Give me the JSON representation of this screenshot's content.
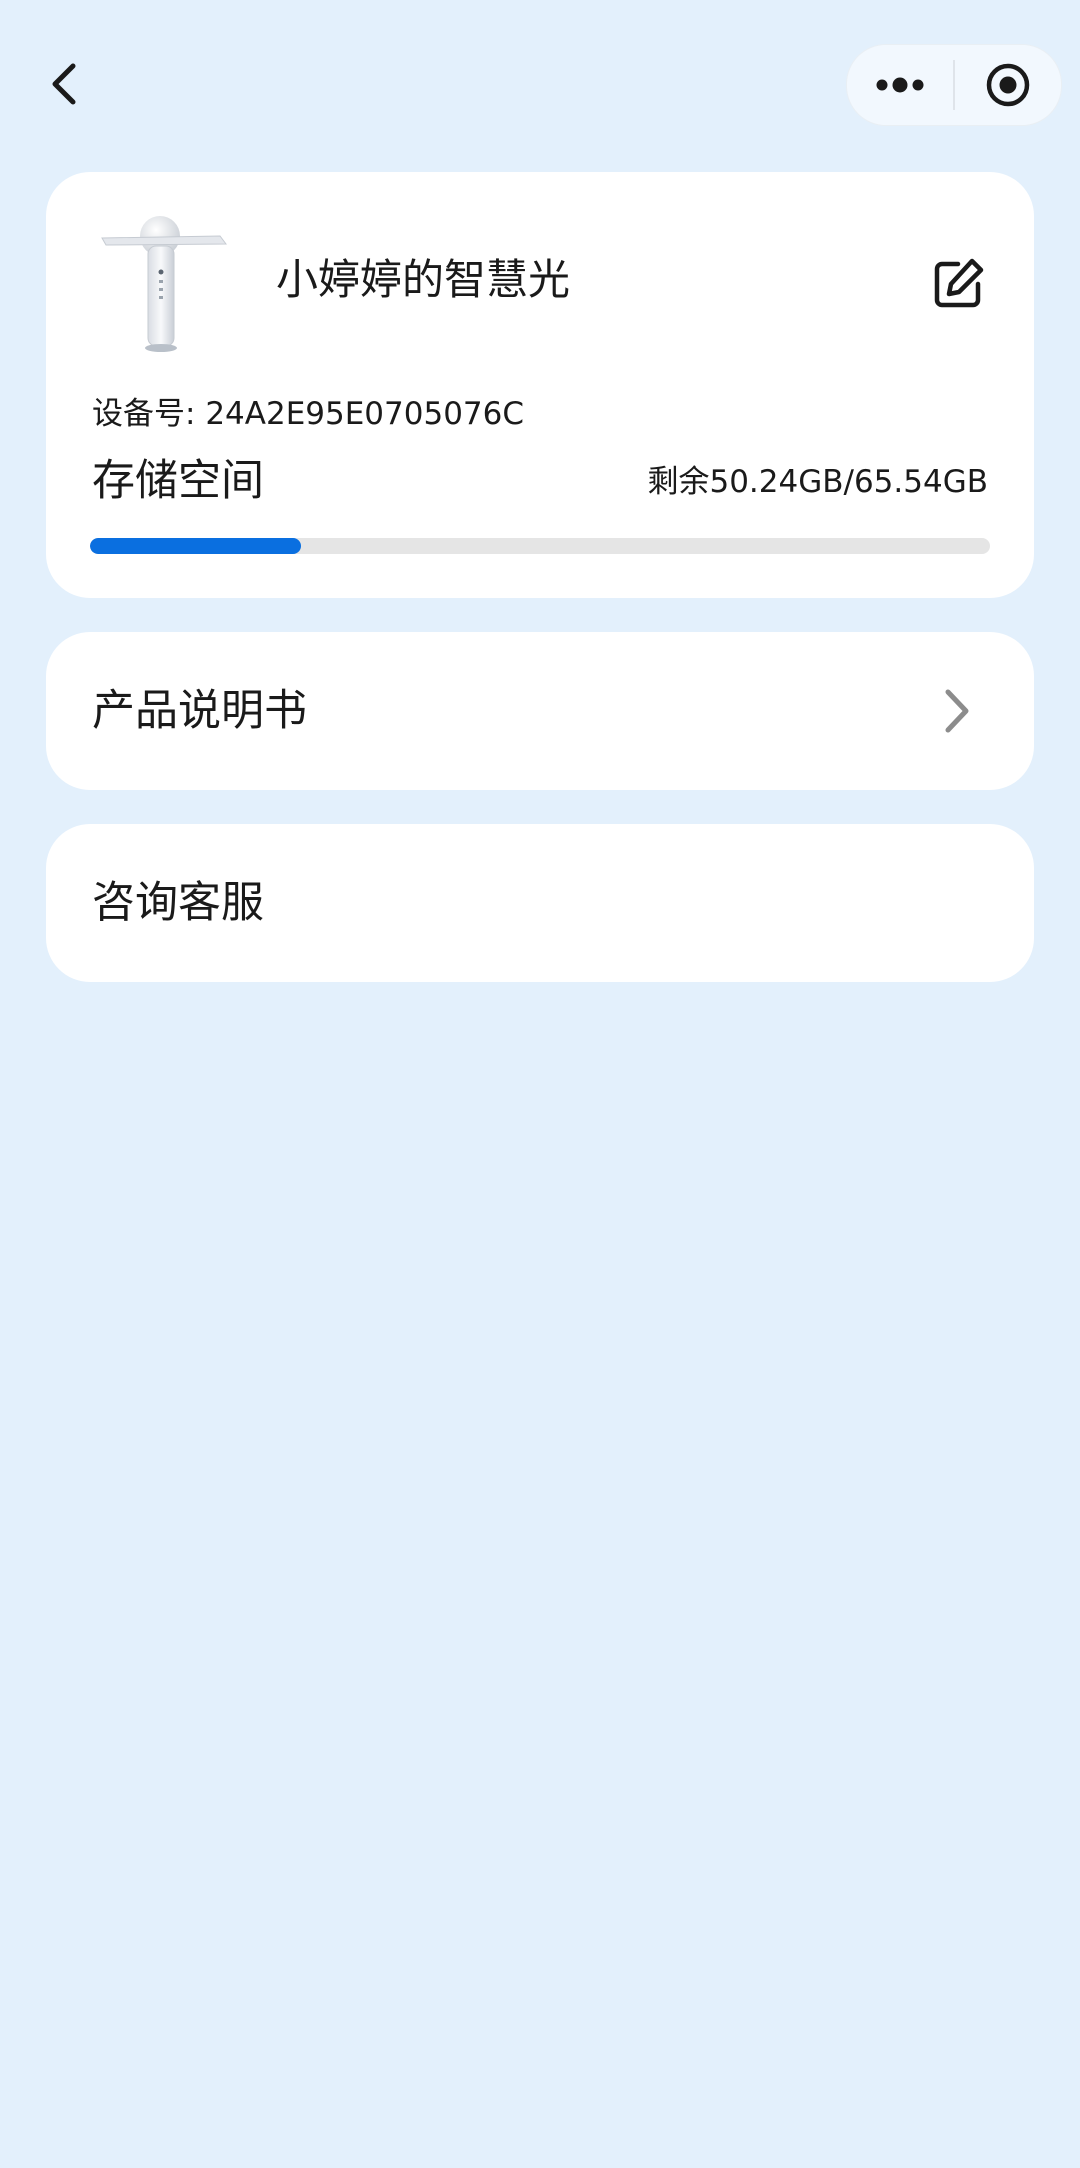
{
  "device": {
    "name": "小婷婷的智慧光",
    "serial_label": "设备号:",
    "serial_number": "24A2E95E0705076C"
  },
  "storage": {
    "title": "存储空间",
    "remaining_text": "剩余50.24GB/65.54GB",
    "used_fraction": 0.234
  },
  "menu": {
    "manual_label": "产品说明书",
    "service_label": "咨询客服"
  },
  "icons": {
    "back": "chevron-left-icon",
    "more": "more-dots-icon",
    "close": "record-circle-icon",
    "edit": "edit-icon",
    "chevron": "chevron-right-icon"
  },
  "colors": {
    "background": "#e3f0fc",
    "accent": "#0a6fe0",
    "track": "#e5e5e5"
  }
}
